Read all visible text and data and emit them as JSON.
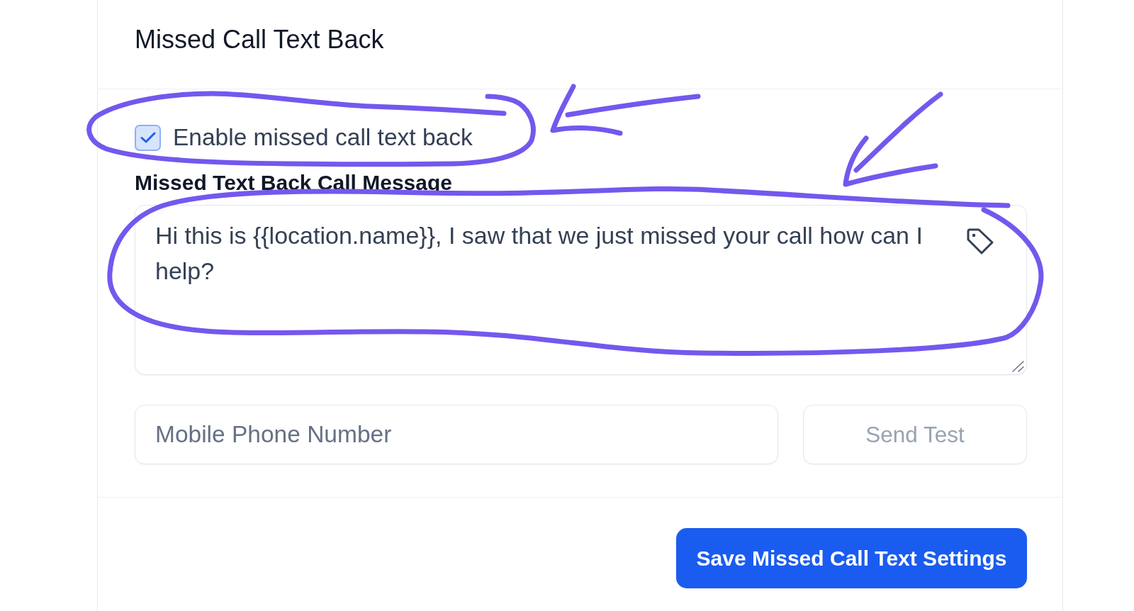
{
  "card": {
    "title": "Missed Call Text Back",
    "enable_checkbox": {
      "label": "Enable missed call text back",
      "checked": true,
      "circled": true
    },
    "message": {
      "label": "Missed Text Back Call Message",
      "value": "Hi this is {{location.name}}, I saw that we just missed your call how can I help?",
      "circled": true
    },
    "test": {
      "phone_field": {
        "placeholder": "Mobile Phone Number"
      },
      "send_button": {
        "label": "Send Test",
        "disabled": true
      }
    },
    "save_button": {
      "label": "Save Missed Call Text Settings"
    }
  }
}
